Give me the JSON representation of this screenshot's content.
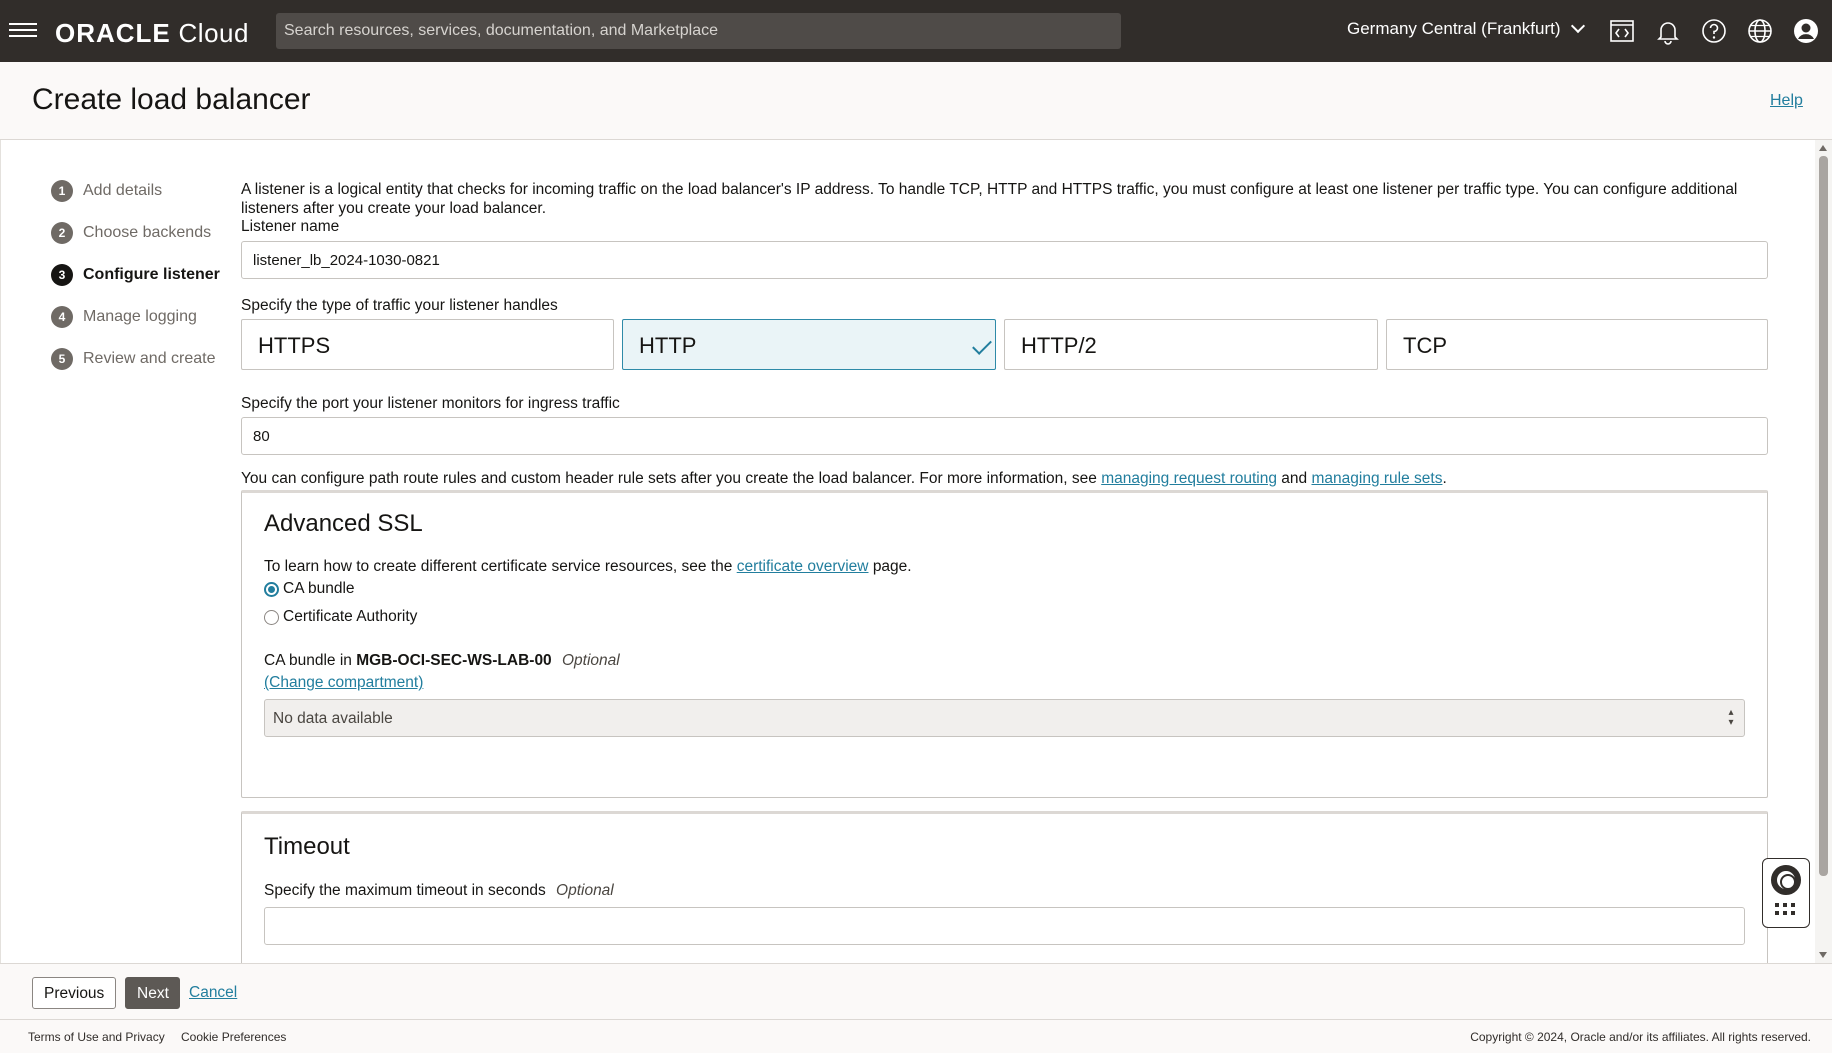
{
  "header": {
    "brand_main": "ORACLE",
    "brand_sub": "Cloud",
    "search_placeholder": "Search resources, services, documentation, and Marketplace",
    "region": "Germany Central (Frankfurt)",
    "icons": [
      "menu-icon",
      "code-editor-icon",
      "bell-icon",
      "help-icon",
      "globe-icon",
      "user-icon"
    ]
  },
  "page": {
    "title": "Create load balancer",
    "help": "Help"
  },
  "steps": [
    {
      "num": "1",
      "label": "Add details"
    },
    {
      "num": "2",
      "label": "Choose backends"
    },
    {
      "num": "3",
      "label": "Configure listener",
      "active": true
    },
    {
      "num": "4",
      "label": "Manage logging"
    },
    {
      "num": "5",
      "label": "Review and create"
    }
  ],
  "listener": {
    "intro": "A listener is a logical entity that checks for incoming traffic on the load balancer's IP address. To handle TCP, HTTP and HTTPS traffic, you must configure at least one listener per traffic type. You can configure additional listeners after you create your load balancer.",
    "name_label": "Listener name",
    "name_value": "listener_lb_2024-1030-0821",
    "traffic_label": "Specify the type of traffic your listener handles",
    "traffic_options": [
      {
        "label": "HTTPS",
        "selected": false
      },
      {
        "label": "HTTP",
        "selected": true
      },
      {
        "label": "HTTP/2",
        "selected": false
      },
      {
        "label": "TCP",
        "selected": false
      }
    ],
    "port_label": "Specify the port your listener monitors for ingress traffic",
    "port_value": "80",
    "info_prefix": "You can configure path route rules and custom header rule sets after you create the load balancer. For more information, see",
    "info_link1": "managing request routing",
    "info_and": "and",
    "info_link2": "managing rule sets",
    "info_suffix": "."
  },
  "advanced_ssl": {
    "title": "Advanced SSL",
    "learn_prefix": "To learn how to create different certificate service resources, see the",
    "learn_link": "certificate overview",
    "learn_suffix": "page.",
    "radio_ca_bundle": "CA bundle",
    "radio_cert_authority": "Certificate Authority",
    "selected_radio": "CA bundle",
    "bundle_label_prefix": "CA bundle in",
    "compartment": "MGB-OCI-SEC-WS-LAB-00",
    "optional": "Optional",
    "change_compartment": "(Change compartment)",
    "select_value": "No data available"
  },
  "timeout": {
    "title": "Timeout",
    "label": "Specify the maximum timeout in seconds",
    "optional": "Optional",
    "value": ""
  },
  "actions": {
    "previous": "Previous",
    "next": "Next",
    "cancel": "Cancel"
  },
  "footer": {
    "terms": "Terms of Use and Privacy",
    "cookies": "Cookie Preferences",
    "copyright": "Copyright © 2024, Oracle and/or its affiliates. All rights reserved."
  },
  "colors": {
    "header_bg": "#312d2a",
    "link": "#227e9e",
    "selected_card_bg": "#eaf4f7",
    "next_button_bg": "#5d5955"
  }
}
